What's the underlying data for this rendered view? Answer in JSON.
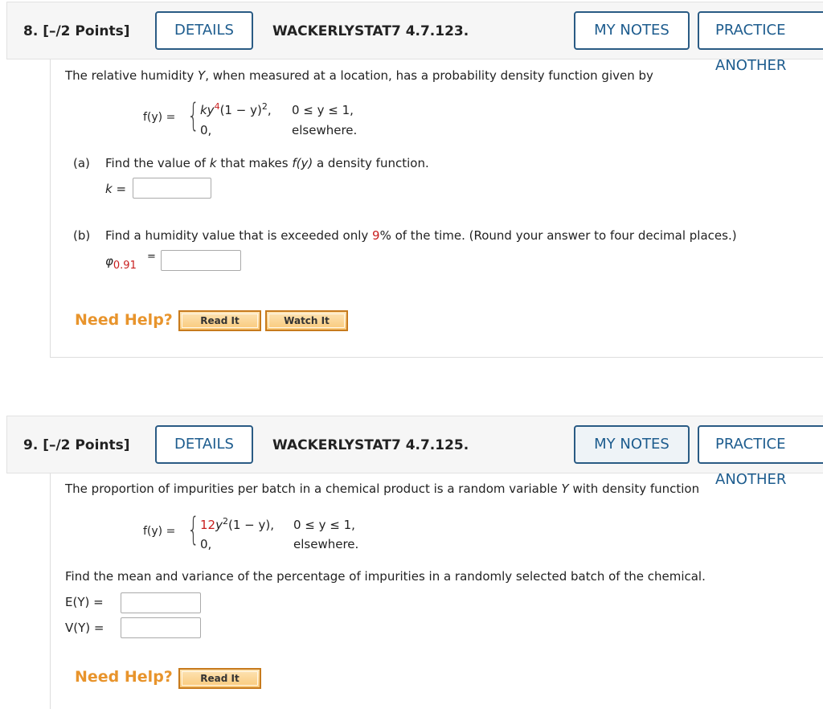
{
  "q8": {
    "number": "8.  [–/2 Points]",
    "details": "DETAILS",
    "code": "WACKERLYSTAT7 4.7.123.",
    "my_notes": "MY NOTES",
    "practice": "PRACTICE ANOTHER",
    "intro_a": "The relative humidity ",
    "intro_var": "Y",
    "intro_b": ", when measured at a location, has a probability density function given by",
    "fy": "f(y)  =",
    "case1_k": "ky",
    "case1_exp": "4",
    "case1_rest": "(1 − y)",
    "case1_sq": "2",
    "case1_comma": ",",
    "case1_cond": "0 ≤ y ≤ 1,",
    "case2": "0,",
    "case2_cond": "elsewhere.",
    "part_a_label": "(a)",
    "part_a_text1": "Find the value of ",
    "part_a_k": "k",
    "part_a_text2": " that makes ",
    "part_a_fy": "f(y)",
    "part_a_text3": " a density function.",
    "k_label": "k  =",
    "part_b_label": "(b)",
    "part_b_text1": "Find a humidity value that is exceeded only ",
    "part_b_pct": "9",
    "part_b_text2": "% of the time. (Round your answer to four decimal places.)",
    "phi": "φ",
    "phi_sub": "0.91",
    "phi_eq": "=",
    "need_help": "Need Help?",
    "read_it": "Read It",
    "watch_it": "Watch It"
  },
  "q9": {
    "number": "9.  [–/2 Points]",
    "details": "DETAILS",
    "code": "WACKERLYSTAT7 4.7.125.",
    "my_notes": "MY NOTES",
    "practice": "PRACTICE ANOTHER",
    "intro_a": "The proportion of impurities per batch in a chemical product is a random variable ",
    "intro_var": "Y",
    "intro_b": " with density function",
    "fy": "f(y)  =",
    "case1_coef": "12",
    "case1_y": "y",
    "case1_exp": "2",
    "case1_rest": "(1 − y),",
    "case1_cond": "0 ≤ y ≤ 1,",
    "case2": "0,",
    "case2_cond": "elsewhere.",
    "question": "Find the mean and variance of the percentage of impurities in a randomly selected batch of the chemical.",
    "ey_label": "E(Y)  =",
    "vy_label": "V(Y)  =",
    "need_help": "Need Help?",
    "read_it": "Read It"
  }
}
